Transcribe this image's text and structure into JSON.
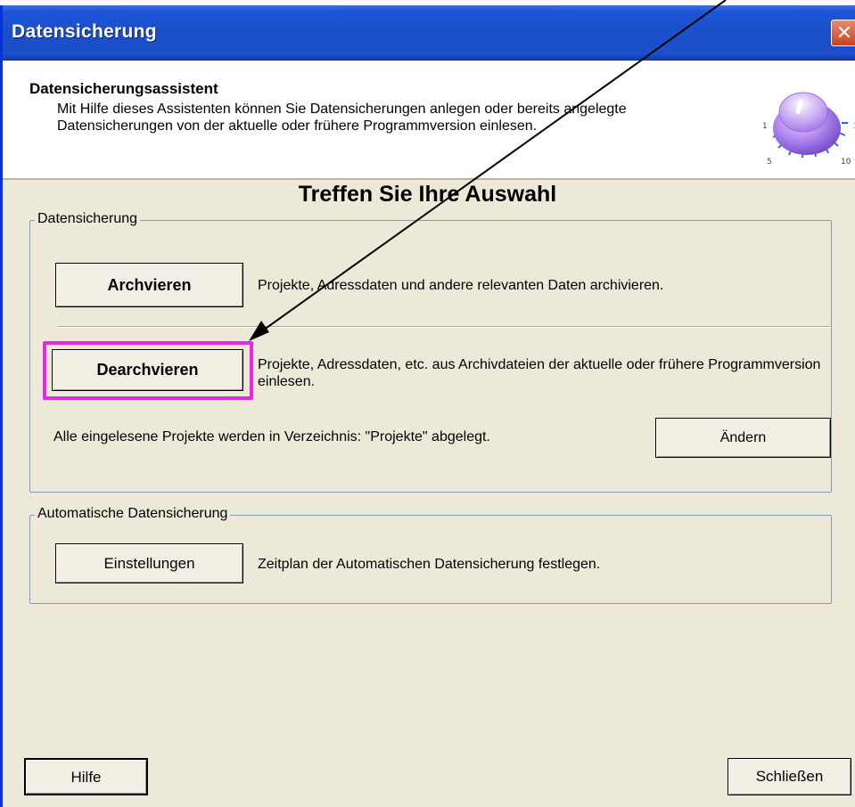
{
  "window": {
    "title": "Datensicherung",
    "close_glyph": "✕"
  },
  "header": {
    "title": "Datensicherungsassistent",
    "description": "Mit Hilfe dieses Assistenten können Sie Datensicherungen anlegen oder bereits angelegte Datensicherungen von der aktuelle oder frühere Programmversion einlesen.",
    "dial_labels": [
      "1",
      "1",
      "5",
      "10"
    ]
  },
  "main": {
    "choose_title": "Treffen Sie Ihre Auswahl",
    "backup_group": {
      "legend": "Datensicherung",
      "archive_button": "Archvieren",
      "archive_desc": "Projekte, Adressdaten und andere relevanten Daten archivieren.",
      "dearchive_button": "Dearchvieren",
      "dearchive_desc": "Projekte, Adressdaten, etc. aus Archivdateien der aktuelle oder frühere Programmversion einlesen.",
      "directory_text": "Alle eingelesene Projekte werden in Verzeichnis: \"Projekte\" abgelegt.",
      "change_button": "Ändern"
    },
    "auto_group": {
      "legend": "Automatische Datensicherung",
      "settings_button": "Einstellungen",
      "settings_desc": "Zeitplan der Automatischen Datensicherung festlegen."
    }
  },
  "footer": {
    "help_button": "Hilfe",
    "close_button": "Schließen"
  },
  "colors": {
    "titlebar": "#1c4fcc",
    "window_bg": "#ece9d8",
    "highlight": "#e22be2",
    "dial": "#b48ef0"
  }
}
